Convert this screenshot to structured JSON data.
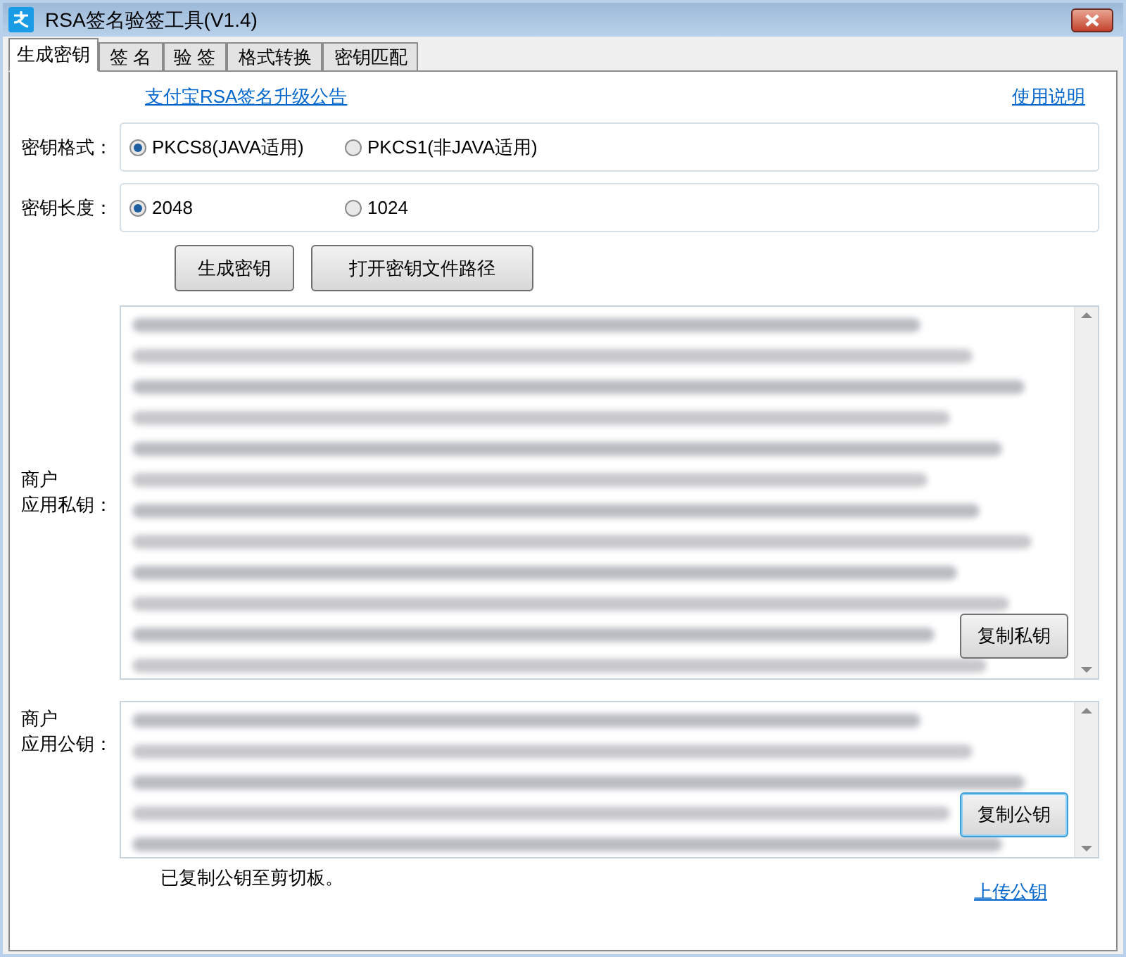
{
  "window": {
    "title": "RSA签名验签工具(V1.4)"
  },
  "tabs": [
    {
      "label": "生成密钥",
      "selected": true
    },
    {
      "label": "签 名",
      "selected": false
    },
    {
      "label": "验 签",
      "selected": false
    },
    {
      "label": "格式转换",
      "selected": false
    },
    {
      "label": "密钥匹配",
      "selected": false
    }
  ],
  "links": {
    "announcement": "支付宝RSA签名升级公告",
    "manual": "使用说明"
  },
  "option_groups": [
    {
      "label": "密钥格式：",
      "options": [
        {
          "label": "PKCS8(JAVA适用)",
          "selected": true
        },
        {
          "label": "PKCS1(非JAVA适用)",
          "selected": false
        }
      ]
    },
    {
      "label": "密钥长度：",
      "options": [
        {
          "label": "2048",
          "selected": true
        },
        {
          "label": "1024",
          "selected": false
        }
      ]
    }
  ],
  "buttons": [
    "生成密钥",
    "打开密钥文件路径"
  ],
  "key_areas": [
    {
      "label_lines": [
        "商户",
        "应用私钥："
      ],
      "copy_button": {
        "label": "复制私钥",
        "focused": false
      }
    },
    {
      "label_lines": [
        "商户",
        "应用公钥："
      ],
      "copy_button": {
        "label": "复制公钥",
        "focused": true
      }
    }
  ],
  "status": "已复制公钥至剪切板。",
  "upload_link": "上传公钥"
}
